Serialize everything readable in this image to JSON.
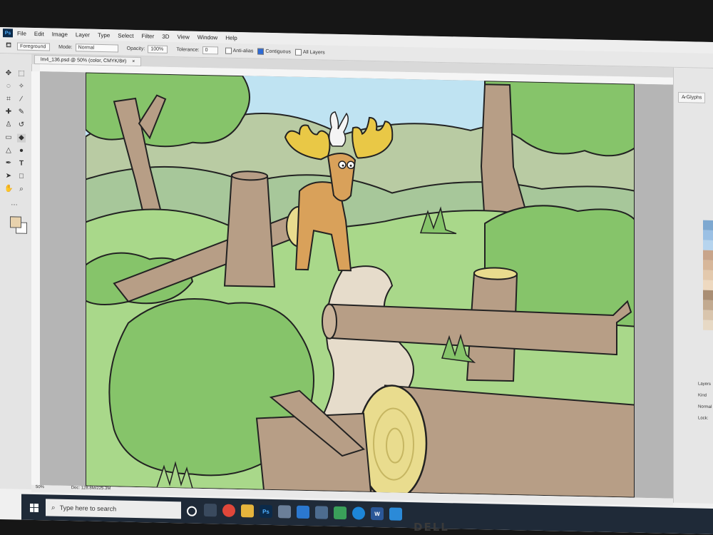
{
  "app": {
    "logo": "Ps",
    "menu": [
      "File",
      "Edit",
      "Image",
      "Layer",
      "Type",
      "Select",
      "Filter",
      "3D",
      "View",
      "Window",
      "Help"
    ]
  },
  "options": {
    "preset": "Foreground",
    "mode_label": "Mode:",
    "mode_value": "Normal",
    "opacity_label": "Opacity:",
    "opacity_value": "100%",
    "tolerance_label": "Tolerance:",
    "tolerance_value": "0",
    "antialias": "Anti-alias",
    "contiguous": "Contiguous",
    "all_layers": "All Layers"
  },
  "document": {
    "tab": "lm4_136.psd @ 50% (color, CMYK/8#)",
    "close": "×"
  },
  "panels": {
    "glyphs": "Glyphs",
    "layers": "Layers",
    "kind": "Kind",
    "normal": "Normal",
    "lock": "Lock:"
  },
  "status": {
    "zoom": "50%",
    "doc": "Doc: 128.8M/225.3M"
  },
  "taskbar": {
    "search_placeholder": "Type here to search"
  },
  "monitor": {
    "brand": "DELL"
  },
  "colors": {
    "sky": "#bfe3f2",
    "grass": "#a9d88a",
    "bush": "#86c46a",
    "log": "#b79e86",
    "stump_top": "#e9dc8e",
    "moose": "#d9a15a"
  }
}
